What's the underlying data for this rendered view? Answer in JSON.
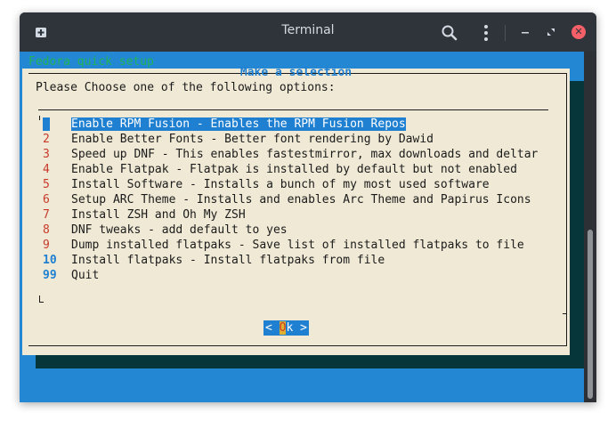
{
  "window": {
    "title": "Terminal",
    "icons": {
      "new_tab": "new-tab-icon",
      "search": "search-icon",
      "menu": "menu-icon",
      "minimize": "minimize-icon",
      "maximize": "maximize-icon",
      "close": "close-icon"
    }
  },
  "terminal": {
    "backtitle": "Fedora quick setup",
    "dialog": {
      "title": "Make a selection",
      "prompt": "Please Choose one of the following options:",
      "items": [
        {
          "num": "1",
          "label": "Enable RPM Fusion - Enables the RPM Fusion Repos",
          "selected": true
        },
        {
          "num": "2",
          "label": "Enable Better Fonts - Better font rendering by Dawid"
        },
        {
          "num": "3",
          "label": "Speed up DNF - This enables fastestmirror, max downloads and deltar"
        },
        {
          "num": "4",
          "label": "Enable Flatpak - Flatpak is installed by default but not enabled"
        },
        {
          "num": "5",
          "label": "Install Software - Installs a bunch of my most used software"
        },
        {
          "num": "6",
          "label": "Setup ARC Theme - Installs and enables Arc Theme and Papirus Icons"
        },
        {
          "num": "7",
          "label": "Install ZSH and Oh My ZSH"
        },
        {
          "num": "8",
          "label": "DNF tweaks - add default to yes"
        },
        {
          "num": "9",
          "label": "Dump installed flatpaks - Save list of installed flatpaks to file"
        },
        {
          "num": "10",
          "label": "Install flatpaks - Install flatpaks from file"
        },
        {
          "num": "99",
          "label": "Quit"
        }
      ],
      "ok_button": {
        "left": "< ",
        "hotkey": "O",
        "rest": "k",
        "right": " >"
      }
    }
  },
  "colors": {
    "terminal_bg": "#2387d4",
    "dialog_bg": "#efe9d5",
    "highlight": "#1f7fd0",
    "number_red": "#c83a2c",
    "backtitle_green": "#20b458"
  }
}
